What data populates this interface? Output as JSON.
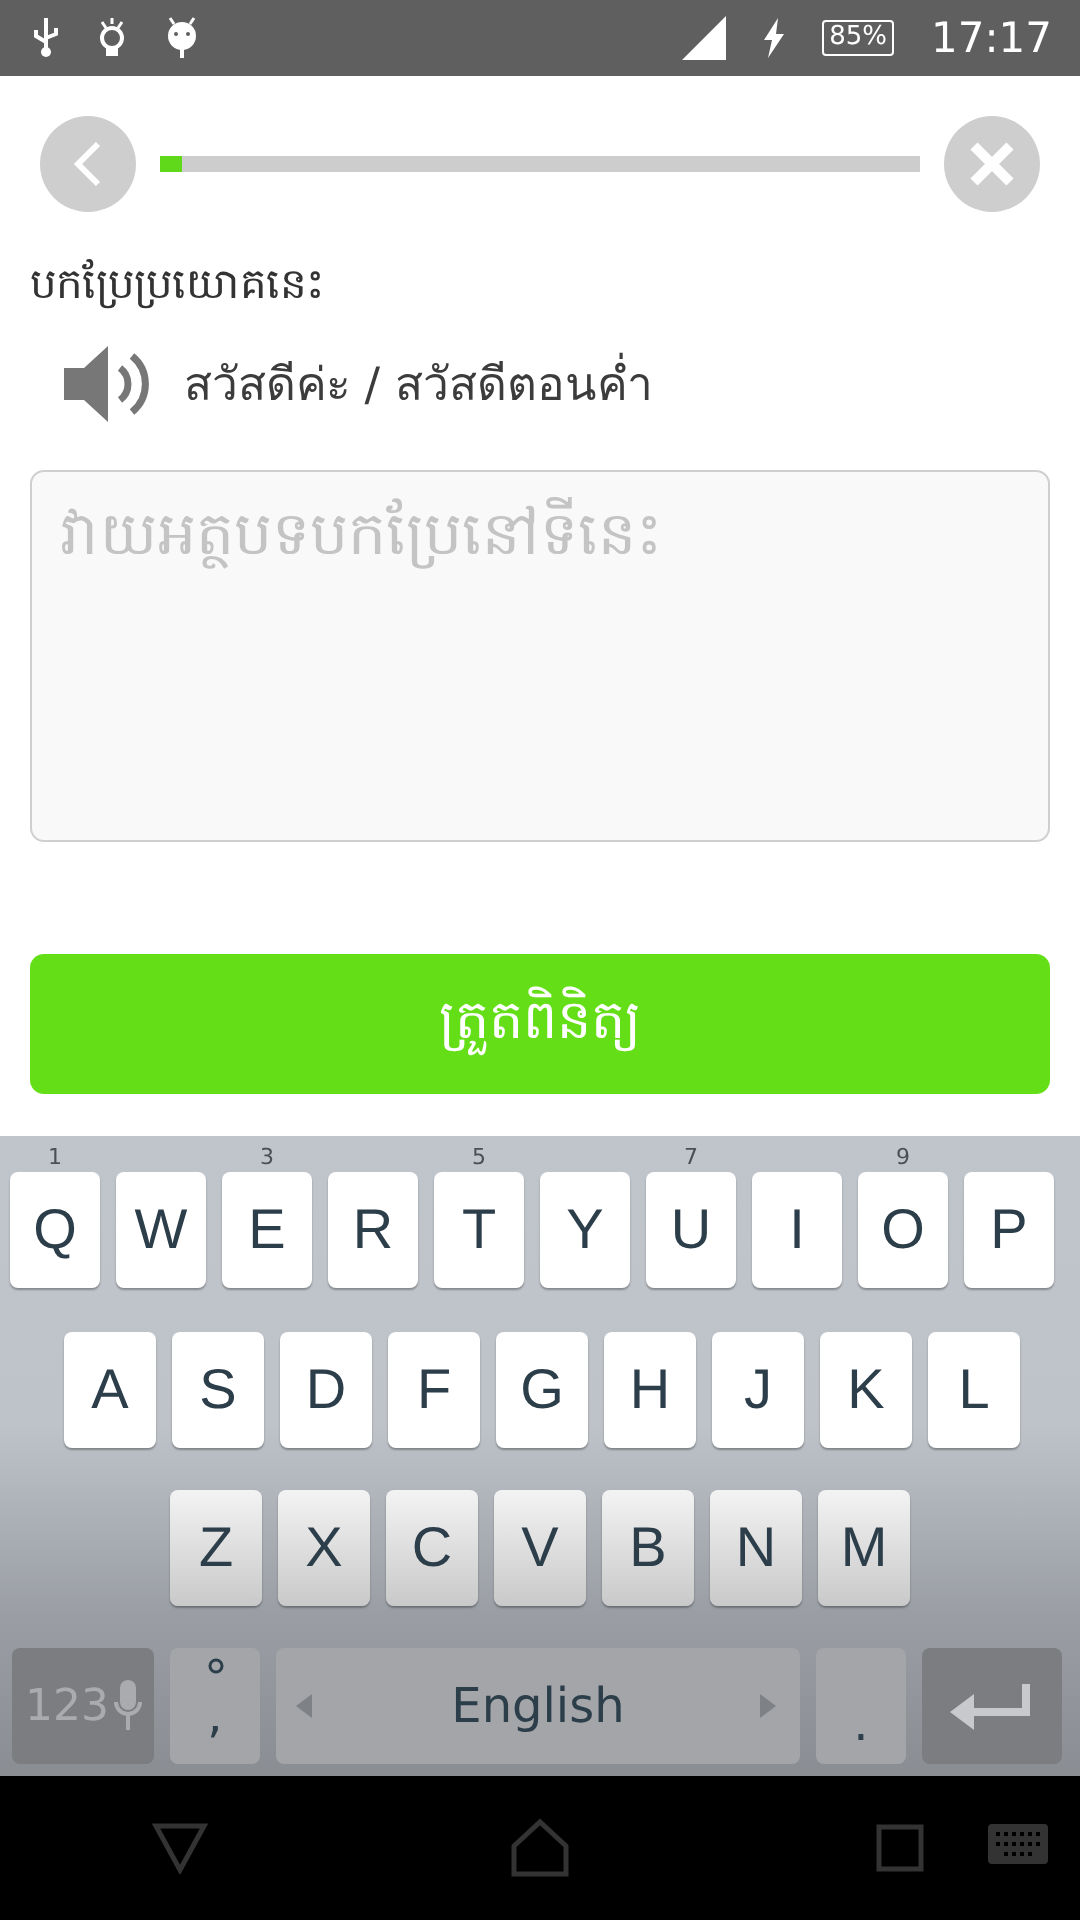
{
  "status_bar": {
    "battery": "85%",
    "time": "17:17"
  },
  "lesson": {
    "progress": {
      "level": 0.03
    },
    "prompt": "បកប្រែប្រយោគនេះ",
    "sentence": "สวัสดีค่ะ / สวัสดีตอนค่ำ",
    "answer": {
      "placeholder": "វាយអត្ថបទបកប្រែនៅទីនេះ"
    },
    "check_button": "ត្រួតពិនិត្យ"
  },
  "keyboard": {
    "rows": [
      [
        {
          "label": "Q",
          "hint": "1"
        },
        {
          "label": "W"
        },
        {
          "label": "E",
          "hint": "3"
        },
        {
          "label": "R"
        },
        {
          "label": "T",
          "hint": "5"
        },
        {
          "label": "Y"
        },
        {
          "label": "U",
          "hint": "7"
        },
        {
          "label": "I"
        },
        {
          "label": "O",
          "hint": "9"
        },
        {
          "label": "P"
        }
      ],
      [
        {
          "label": "A"
        },
        {
          "label": "S"
        },
        {
          "label": "D"
        },
        {
          "label": "F"
        },
        {
          "label": "G"
        },
        {
          "label": "H"
        },
        {
          "label": "J"
        },
        {
          "label": "K"
        },
        {
          "label": "L"
        }
      ],
      [
        {
          "label": "Z"
        },
        {
          "label": "X"
        },
        {
          "label": "C"
        },
        {
          "label": "V"
        },
        {
          "label": "B"
        },
        {
          "label": "N"
        },
        {
          "label": "M"
        }
      ]
    ],
    "numbers_key": "123",
    "comma_key": ",",
    "space_key": "English",
    "period_key": "."
  }
}
